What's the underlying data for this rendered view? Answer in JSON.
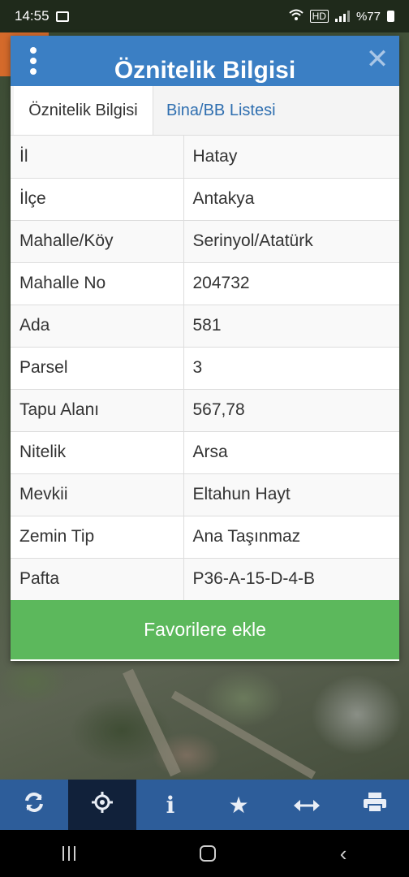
{
  "status_bar": {
    "time": "14:55",
    "battery_text": "%77"
  },
  "dialog": {
    "title": "Öznitelik Bilgisi",
    "tabs": [
      {
        "label": "Öznitelik Bilgisi",
        "active": true
      },
      {
        "label": "Bina/BB Listesi",
        "active": false
      }
    ],
    "rows": [
      {
        "key": "İl",
        "value": "Hatay"
      },
      {
        "key": "İlçe",
        "value": "Antakya"
      },
      {
        "key": "Mahalle/Köy",
        "value": "Serinyol/Atatürk"
      },
      {
        "key": "Mahalle No",
        "value": "204732"
      },
      {
        "key": "Ada",
        "value": "581"
      },
      {
        "key": "Parsel",
        "value": "3"
      },
      {
        "key": "Tapu Alanı",
        "value": "567,78"
      },
      {
        "key": "Nitelik",
        "value": "Arsa"
      },
      {
        "key": "Mevkii",
        "value": "Eltahun Hayt"
      },
      {
        "key": "Zemin Tip",
        "value": "Ana Taşınmaz"
      },
      {
        "key": "Pafta",
        "value": "P36-A-15-D-4-B"
      }
    ],
    "favorite_button": "Favorilere ekle"
  },
  "toolbar": {
    "items": [
      {
        "icon": "refresh-icon",
        "active": false
      },
      {
        "icon": "crosshair-icon",
        "active": true
      },
      {
        "icon": "info-icon",
        "active": false
      },
      {
        "icon": "star-icon",
        "active": false
      },
      {
        "icon": "measure-icon",
        "active": false
      },
      {
        "icon": "print-icon",
        "active": false
      }
    ]
  },
  "colors": {
    "header_blue": "#3b7fc4",
    "button_green": "#5cb85c",
    "toolbar_blue": "#2d5d9a",
    "toolbar_active": "#11213a"
  }
}
